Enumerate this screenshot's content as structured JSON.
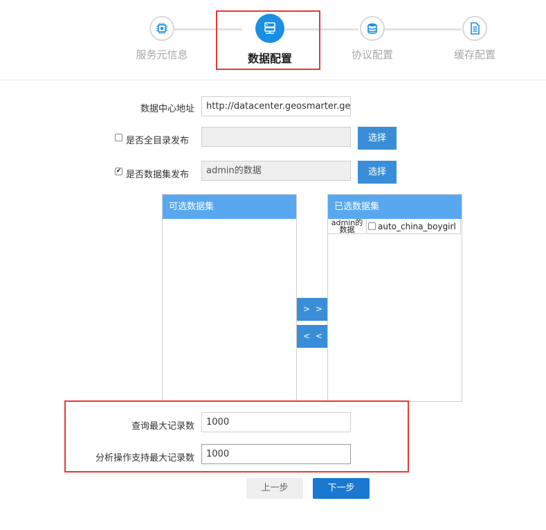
{
  "stepper": {
    "steps": [
      {
        "label": "服务元信息",
        "icon": "chip-icon",
        "active": false
      },
      {
        "label": "数据配置",
        "icon": "server-icon",
        "active": true
      },
      {
        "label": "协议配置",
        "icon": "database-icon",
        "active": false
      },
      {
        "label": "缓存配置",
        "icon": "document-icon",
        "active": false
      }
    ]
  },
  "form": {
    "datacenter": {
      "label": "数据中心地址",
      "value": "http://datacenter.geosmarter.geo"
    },
    "full_catalog": {
      "label": "是否全目录发布",
      "checked": false,
      "value": "",
      "select_label": "选择"
    },
    "dataset_publish": {
      "label": "是否数据集发布",
      "checked": true,
      "value": "admin的数据",
      "select_label": "选择"
    }
  },
  "dual_list": {
    "available_header": "可选数据集",
    "selected_header": "已选数据集",
    "selected_items": [
      {
        "group": "admin的\n数据",
        "name": "auto_china_boygirl",
        "checked": false
      }
    ],
    "move_right_label": "> >",
    "move_left_label": "< <"
  },
  "limits": {
    "query_max": {
      "label": "查询最大记录数",
      "value": "1000"
    },
    "analysis_max": {
      "label": "分析操作支持最大记录数",
      "value": "1000"
    }
  },
  "buttons": {
    "prev": "上一步",
    "next": "下一步"
  }
}
